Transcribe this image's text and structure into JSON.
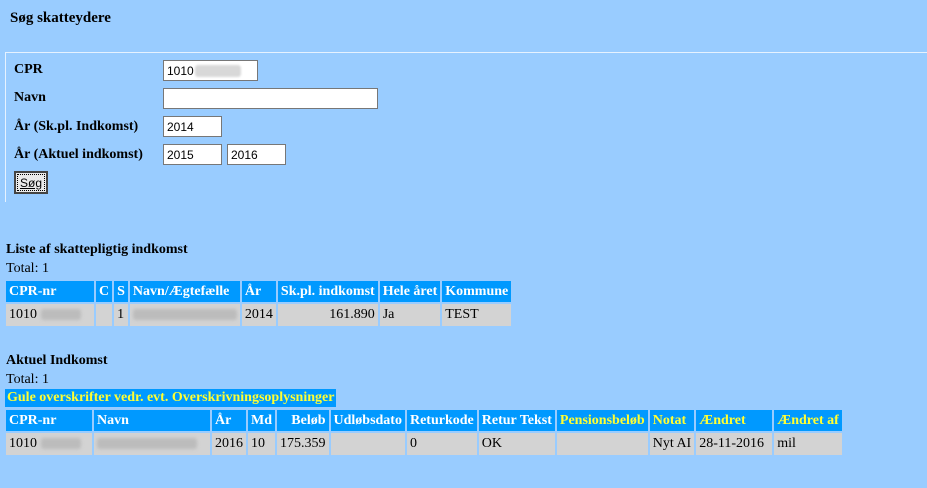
{
  "page": {
    "title": "Søg skatteydere"
  },
  "search": {
    "cpr_label": "CPR",
    "cpr_value": "1010",
    "name_label": "Navn",
    "name_value": "",
    "year_taxable_label": "År (Sk.pl. Indkomst)",
    "year_taxable_value": "2014",
    "year_current_label": "År (Aktuel indkomst)",
    "year_current_from": "2015",
    "year_current_to": "2016",
    "search_button": "Søg"
  },
  "taxable": {
    "title": "Liste af skattepligtig indkomst",
    "total": "Total: 1",
    "headers": [
      "CPR-nr",
      "C",
      "S",
      "Navn/Ægtefælle",
      "År",
      "Sk.pl. indkomst",
      "Hele året",
      "Kommune"
    ],
    "rows": [
      {
        "cpr": "1010",
        "c": "",
        "s": "1",
        "name": "",
        "year": "2014",
        "income": "161.890",
        "whole_year": "Ja",
        "municipality": "TEST"
      }
    ]
  },
  "current": {
    "title": "Aktuel Indkomst",
    "total": "Total: 1",
    "banner": "Gule overskrifter vedr. evt. Overskrivningsoplysninger",
    "headers": [
      "CPR-nr",
      "Navn",
      "År",
      "Md",
      "Beløb",
      "Udløbsdato",
      "Returkode",
      "Retur Tekst",
      "Pensionsbeløb",
      "Notat",
      "Ændret",
      "Ændret af"
    ],
    "rows": [
      {
        "cpr": "1010",
        "name": "",
        "year": "2016",
        "month": "10",
        "amount": "175.359",
        "expiry": "",
        "return_code": "0",
        "return_text": "OK",
        "pension": "",
        "note": "Nyt AI",
        "changed": "28-11-2016",
        "changed_by": "mil"
      }
    ]
  },
  "colors": {
    "background": "#99ccff",
    "header": "#0099ff",
    "override_header_text": "#ffff33",
    "cell": "#d3d3d3"
  }
}
